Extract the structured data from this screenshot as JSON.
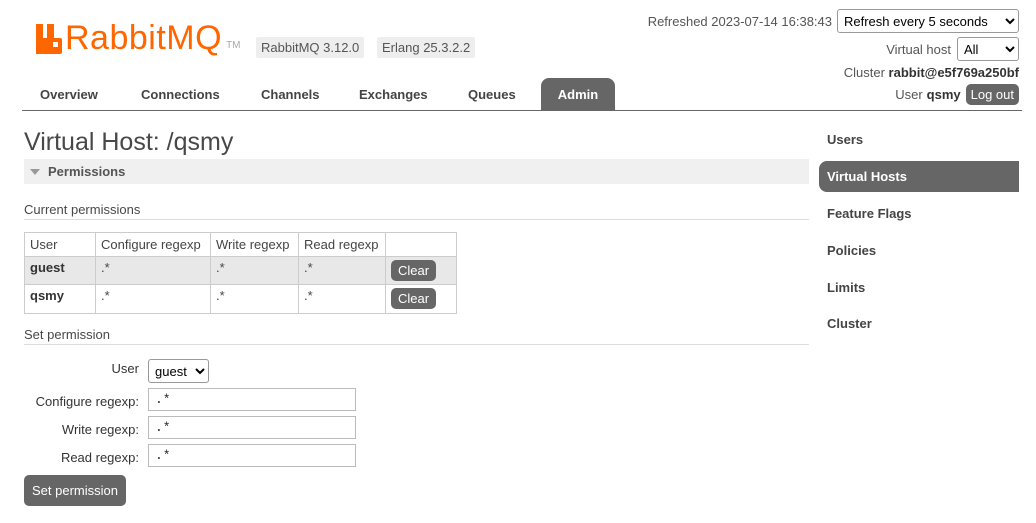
{
  "header": {
    "logo_text": "RabbitMQ",
    "logo_tm": "TM",
    "version_badge": "RabbitMQ 3.12.0",
    "erlang_badge": "Erlang 25.3.2.2",
    "refreshed_text": "Refreshed 2023-07-14 16:38:43",
    "refresh_select": "Refresh every 5 seconds",
    "virtual_host_label": "Virtual host",
    "virtual_host_select": "All",
    "cluster_label": "Cluster",
    "cluster_name": "rabbit@e5f769a250bf",
    "user_label": "User",
    "user_name": "qsmy",
    "logout_label": "Log out"
  },
  "nav": {
    "tabs": [
      {
        "label": "Overview"
      },
      {
        "label": "Connections"
      },
      {
        "label": "Channels"
      },
      {
        "label": "Exchanges"
      },
      {
        "label": "Queues"
      },
      {
        "label": "Admin"
      }
    ],
    "active": "Admin"
  },
  "main": {
    "title": "Virtual Host: /qsmy",
    "section_title": "Permissions",
    "current_permissions_heading": "Current permissions",
    "table": {
      "columns": [
        "User",
        "Configure regexp",
        "Write regexp",
        "Read regexp",
        ""
      ],
      "rows": [
        {
          "user": "guest",
          "configure": ".*",
          "write": ".*",
          "read": ".*",
          "action": "Clear"
        },
        {
          "user": "qsmy",
          "configure": ".*",
          "write": ".*",
          "read": ".*",
          "action": "Clear"
        }
      ]
    },
    "set_permission_heading": "Set permission",
    "form": {
      "user_label": "User",
      "user_select": "guest",
      "configure_label": "Configure regexp:",
      "configure_value": ".*",
      "write_label": "Write regexp:",
      "write_value": ".*",
      "read_label": "Read regexp:",
      "read_value": ".*",
      "submit_label": "Set permission"
    }
  },
  "sidebar": {
    "items": [
      {
        "label": "Users"
      },
      {
        "label": "Virtual Hosts"
      },
      {
        "label": "Feature Flags"
      },
      {
        "label": "Policies"
      },
      {
        "label": "Limits"
      },
      {
        "label": "Cluster"
      }
    ],
    "active": "Virtual Hosts"
  },
  "colors": {
    "brand": "#ff6600",
    "accent": "#666666"
  }
}
